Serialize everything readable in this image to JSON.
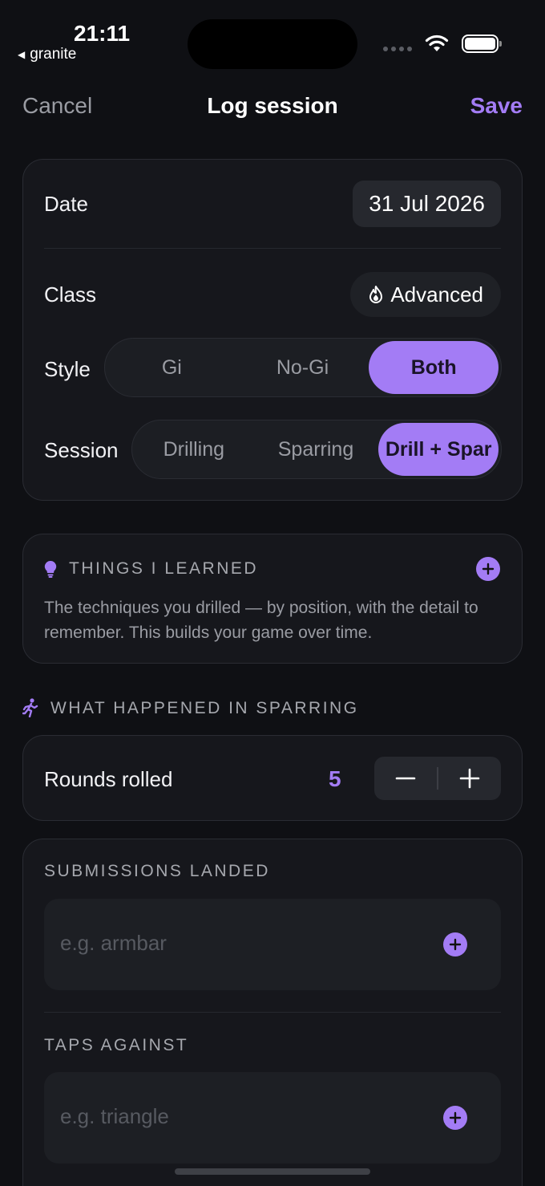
{
  "status_bar": {
    "time": "21:11",
    "back_app": "granite"
  },
  "nav": {
    "cancel": "Cancel",
    "title": "Log session",
    "save": "Save"
  },
  "details": {
    "date_label": "Date",
    "date_value": "31 Jul 2026",
    "class_label": "Class",
    "class_value": "Advanced",
    "style_label": "Style",
    "style_options": [
      "Gi",
      "No-Gi",
      "Both"
    ],
    "style_selected": "Both",
    "session_label": "Session",
    "session_options": [
      "Drilling",
      "Sparring",
      "Drill + Spar"
    ],
    "session_selected": "Drill + Spar"
  },
  "learned": {
    "heading": "THINGS I LEARNED",
    "description": "The techniques you drilled — by position, with the detail to remember. This builds your game over time."
  },
  "sparring": {
    "heading": "WHAT HAPPENED IN SPARRING",
    "rounds_label": "Rounds rolled",
    "rounds_value": "5",
    "submissions_heading": "SUBMISSIONS LANDED",
    "submissions_placeholder": "e.g. armbar",
    "taps_heading": "TAPS AGAINST",
    "taps_placeholder": "e.g. triangle"
  },
  "colors": {
    "accent": "#a37cf5",
    "background": "#0f1014",
    "card": "#16171c"
  },
  "icons": {
    "class": "flame-icon",
    "learned": "lightbulb-icon",
    "sparring": "running-person-icon"
  }
}
